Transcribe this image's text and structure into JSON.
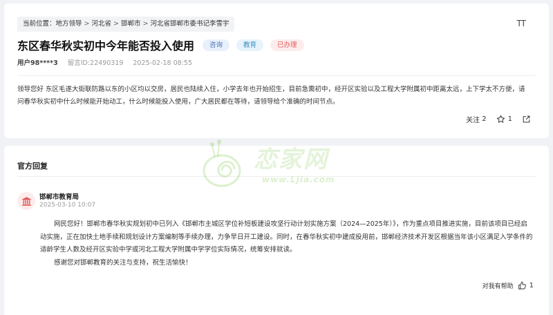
{
  "breadcrumb": {
    "prefix": "当前位置：",
    "items": [
      "地方领导",
      "河北省",
      "邯郸市",
      "河北省邯郸市委书记李雪宇"
    ],
    "separator": ">"
  },
  "font_size_label": "TT",
  "post": {
    "title": "东区春华秋实初中今年能否投入使用",
    "tags": [
      "咨询",
      "教育",
      "已办理"
    ],
    "user": "用户98****3",
    "message_id": "留言ID:22490319",
    "date": "2025-02-18 08:55",
    "content": "领导您好  东区毛遂大街联防路以东的小区均以交房，居民也陆续入住，小学去年也开始招生，目前急需初中，经开区实验以及工程大学附属初中距离太远，上下学太不方便，请问春华秋实初中什么时候能开始动工，什么时候能投入使用，广大居民都在等待，请领导给个准确的时间节点。",
    "follow_label": "关注",
    "follow_count": "2",
    "star_count": "1"
  },
  "reply_section": {
    "title": "官方回复",
    "org_name": "邯郸市教育局",
    "time": "2025-03-10 10:07",
    "paragraphs": [
      "网民您好！邯郸市春华秋实规划初中已列入《邯郸市主城区学位补短板建设攻坚行动计划实施方案（2024—2025年）》，作为重点项目推进实施，目前该项目已经启动实施，正在加快土地手续和规划设计方案编制等手续办理，力争早日开工建设。同时，在春华秋实初中建成投用前，邯郸经济技术开发区根据当年该小区满足入学条件的适龄学生人数及经开区实验中学或河北工程大学附属中学学位实际情况，统筹安排就读。",
      "感谢您对邯郸教育的关注与支持，祝生活愉快！"
    ],
    "helpful_label": "对我有帮助",
    "helpful_count": "1"
  },
  "watermark": {
    "text": "恋家网",
    "url": "www.Ljia.com"
  },
  "colors": {
    "tag_done": "#e05c5c",
    "tag_edu": "#3f8fc4",
    "tag_consult": "#4a72b8",
    "watermark": "#82c850"
  }
}
